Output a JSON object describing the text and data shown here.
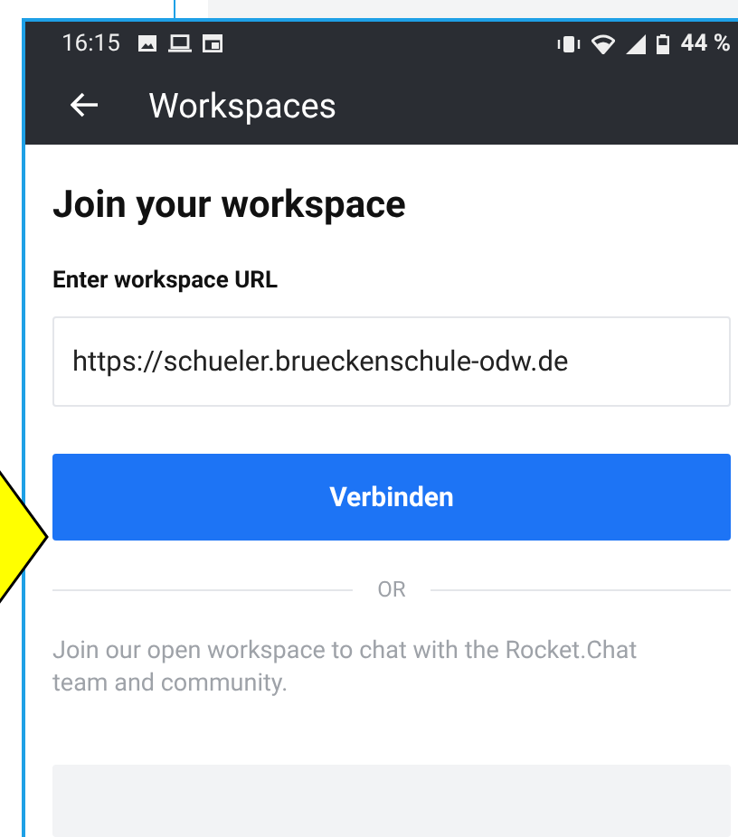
{
  "status_bar": {
    "time": "16:15",
    "battery": "44 %"
  },
  "app_bar": {
    "title": "Workspaces"
  },
  "heading": "Join your workspace",
  "url_field": {
    "label": "Enter workspace URL",
    "value": "https://schueler.brueckenschule-odw.de"
  },
  "connect_button": "Verbinden",
  "divider": "OR",
  "open_workspace_text": "Join our open workspace to chat with the Rocket.Chat team and community."
}
